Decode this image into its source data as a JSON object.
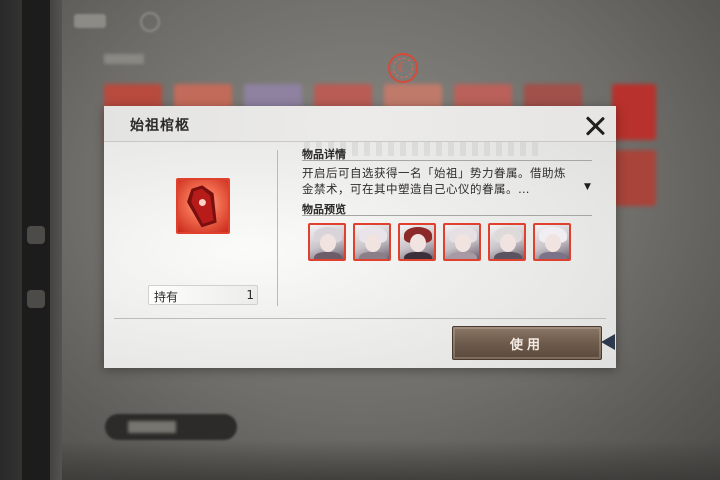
{
  "dialog": {
    "title": "始祖棺柩",
    "close_icon": "close-icon",
    "item_icon": "coffin-icon",
    "hold_label": "持有",
    "hold_count": "1",
    "details_heading": "物品详情",
    "details_text": "开启后可自选获得一名「始祖」势力眷属。借助炼金禁术，可在其中塑造自己心仪的眷属。…",
    "scroll_icon": "chevron-down-icon",
    "preview_heading": "物品预览",
    "previews": [
      {
        "name": "character-portrait-1",
        "hair": "#d9d4da",
        "body": "#6d5c69"
      },
      {
        "name": "character-portrait-2",
        "hair": "#e8e4ea",
        "body": "#8a7e88"
      },
      {
        "name": "character-portrait-3",
        "hair": "#8c2a2a",
        "body": "#3a2f3a"
      },
      {
        "name": "character-portrait-4",
        "hair": "#e6e0e4",
        "body": "#a79aa4"
      },
      {
        "name": "character-portrait-5",
        "hair": "#dedad9",
        "body": "#5b5460"
      },
      {
        "name": "character-portrait-6",
        "hair": "#f0eef2",
        "body": "#7b7488"
      }
    ],
    "use_button": "使用"
  },
  "emblem_icon": "faction-emblem-icon",
  "colors": {
    "accent_red": "#e0412e",
    "button_brown": "#6e5b4c",
    "dialog_bg": "#eeeeec"
  }
}
